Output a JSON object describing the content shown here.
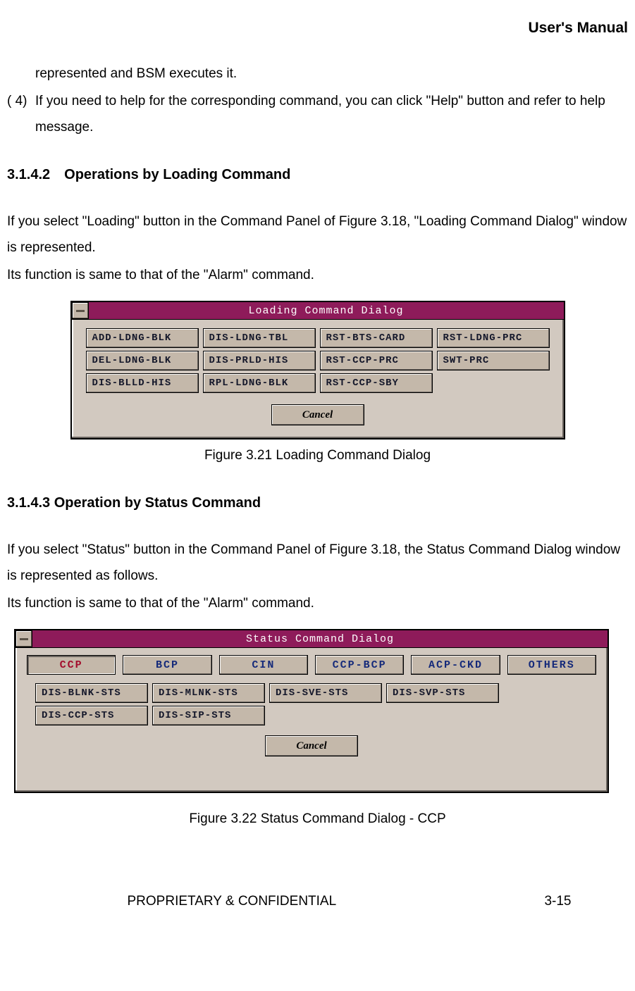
{
  "header": {
    "title": "User's Manual"
  },
  "body": {
    "line1": "represented and BSM executes it.",
    "item4_num": "( 4)",
    "item4_text": "If you need to help for the corresponding command, you can click \"Help\" button and refer to help message."
  },
  "section1": {
    "heading": "3.1.4.2 Operations by Loading Command",
    "para1": "If you select \"Loading\" button in the Command Panel of Figure 3.18, \"Loading Command Dialog\" window is represented.",
    "para2": "Its function is same to that of the \"Alarm\" command."
  },
  "dialog1": {
    "title": "Loading Command Dialog",
    "rows": [
      [
        "ADD-LDNG-BLK",
        "DIS-LDNG-TBL",
        "RST-BTS-CARD",
        "RST-LDNG-PRC"
      ],
      [
        "DEL-LDNG-BLK",
        "DIS-PRLD-HIS",
        "RST-CCP-PRC",
        "SWT-PRC"
      ],
      [
        "DIS-BLLD-HIS",
        "RPL-LDNG-BLK",
        "RST-CCP-SBY",
        ""
      ]
    ],
    "cancel": "Cancel"
  },
  "caption1": "Figure 3.21  Loading Command Dialog",
  "section2": {
    "heading": "3.1.4.3 Operation by Status Command",
    "para1": "If you select \"Status\" button in the Command Panel of Figure 3.18, the Status Command Dialog window is represented as follows.",
    "para2": "Its function is same to that of the \"Alarm\" command."
  },
  "dialog2": {
    "title": "Status Command Dialog",
    "tabs": [
      "CCP",
      "BCP",
      "CIN",
      "CCP-BCP",
      "ACP-CKD",
      "OTHERS"
    ],
    "active_tab_index": 0,
    "rows": [
      [
        "DIS-BLNK-STS",
        "DIS-MLNK-STS",
        "DIS-SVE-STS",
        "DIS-SVP-STS"
      ],
      [
        "DIS-CCP-STS",
        "DIS-SIP-STS",
        "",
        ""
      ]
    ],
    "cancel": "Cancel"
  },
  "caption2": "Figure 3.22 Status Command Dialog - CCP",
  "footer": {
    "left": "PROPRIETARY & CONFIDENTIAL",
    "right": "3-15"
  }
}
